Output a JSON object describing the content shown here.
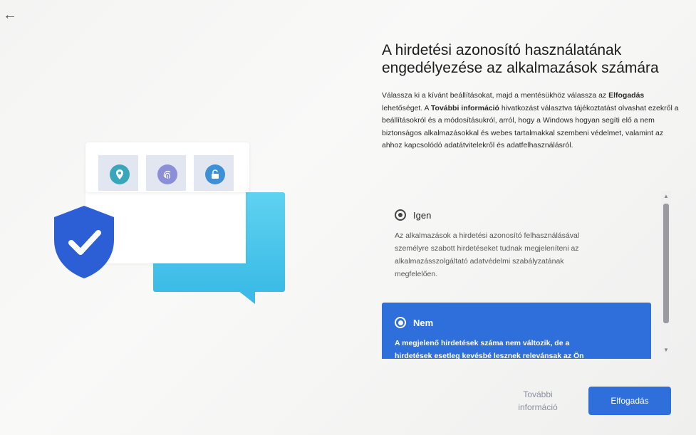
{
  "nav": {
    "back_icon": "back-arrow-icon"
  },
  "header": {
    "title": "A hirdetési azonosító használatának engedélyezése az alkalmazások számára"
  },
  "description": {
    "part1": "Válassza ki a kívánt beállításokat, majd a mentésükhöz válassza az ",
    "bold1": "Elfogadás",
    "part2": " lehetőséget. A ",
    "bold2": "További információ",
    "part3": " hivatkozást választva tájékoztatást olvashat ezekről a beállításokról és a módosításukról, arról, hogy a Windows hogyan segíti elő a nem biztonságos alkalmazásokkal és webes tartalmakkal szembeni védelmet, valamint az ahhoz kapcsolódó adatátvitelekről és adatfelhasználásról."
  },
  "options": [
    {
      "label": "Igen",
      "text": "Az alkalmazások a hirdetési azonosító felhasználásával személyre szabott hirdetéseket tudnak megjeleníteni az alkalmazásszolgáltató adatvédelmi szabályzatának megfelelően.",
      "selected": false
    },
    {
      "label": "Nem",
      "text": "A megjelenő hirdetések száma nem változik, de a hirdetések esetleg kevésbé lesznek relevánsak az Ön",
      "selected": true
    }
  ],
  "footer": {
    "more_info": "További információ",
    "accept": "Elfogadás"
  },
  "illustration": {
    "icons": [
      "location-pin-icon",
      "fingerprint-icon",
      "unlock-icon",
      "shield-check-icon"
    ]
  },
  "colors": {
    "accent": "#2f6fdb",
    "chat_bubble": "#3bbbe7",
    "shield": "#2c5fd6",
    "location_icon": "#3aa6b9",
    "fingerprint_icon": "#8a8fd8",
    "lock_icon": "#3d8fd6"
  }
}
